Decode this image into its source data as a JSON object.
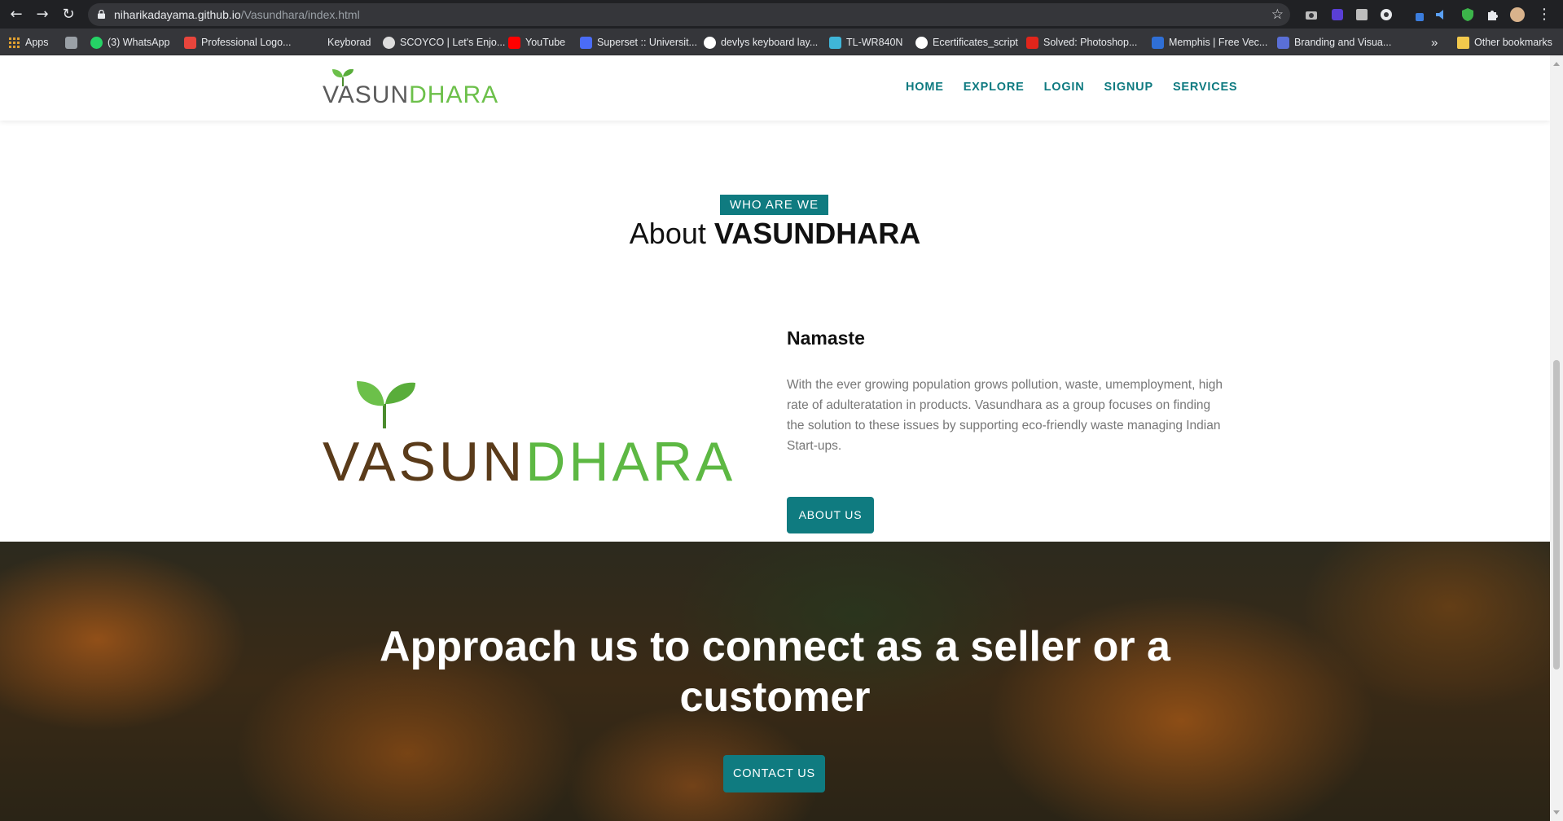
{
  "browser": {
    "url_host": "niharikadayama.github.io",
    "url_path": "/Vasundhara/index.html",
    "bookmarks": [
      {
        "label": "Apps",
        "icon": "apps-grid-icon",
        "color": "#e0a030"
      },
      {
        "label": "",
        "icon": "bookmark-icon",
        "color": "#9aa0a6"
      },
      {
        "label": "(3) WhatsApp",
        "icon": "whatsapp-icon",
        "color": "#25d366"
      },
      {
        "label": "Professional Logo...",
        "icon": "logo-site-icon",
        "color": "#e8453c"
      },
      {
        "label": "Keyborad",
        "icon": "",
        "color": ""
      },
      {
        "label": "SCOYCO | Let's Enjo...",
        "icon": "scoyco-icon",
        "color": "#dddddd"
      },
      {
        "label": "YouTube",
        "icon": "youtube-icon",
        "color": "#ff0000"
      },
      {
        "label": "Superset :: Universit...",
        "icon": "superset-icon",
        "color": "#4a6cf7"
      },
      {
        "label": "devlys keyboard lay...",
        "icon": "google-icon",
        "color": "#ffffff"
      },
      {
        "label": "TL-WR840N",
        "icon": "tplink-icon",
        "color": "#3fb5d8"
      },
      {
        "label": "Ecertificates_script",
        "icon": "github-icon",
        "color": "#ffffff"
      },
      {
        "label": "Solved: Photoshop...",
        "icon": "adobe-icon",
        "color": "#e1251b"
      },
      {
        "label": "Memphis | Free Vec...",
        "icon": "freepik-icon",
        "color": "#2f6fd6"
      },
      {
        "label": "Branding and Visua...",
        "icon": "ieee-icon",
        "color": "#5a6fd6"
      }
    ],
    "more_label": "»",
    "other_bookmarks": "Other bookmarks"
  },
  "site": {
    "brand": {
      "part_a": "VASUN",
      "part_b": "DHARA"
    },
    "nav": [
      "HOME",
      "EXPLORE",
      "LOGIN",
      "SIGNUP",
      "SERVICES"
    ]
  },
  "about": {
    "tag": "WHO ARE WE",
    "title_light": "About",
    "title_strong": "VASUNDHARA",
    "logo_part_a": "VASUN",
    "logo_part_b": "DHARA",
    "heading": "Namaste",
    "text": "With the ever growing population grows pollution, waste, umemployment, high rate of adulteratation in products. Vasundhara as a group focuses on finding the solution to these issues by supporting eco-friendly waste managing Indian Start-ups.",
    "button": "ABOUT US"
  },
  "cta": {
    "title": "Approach us to connect as a seller or a customer",
    "button": "CONTACT US"
  },
  "colors": {
    "accent": "#0f7b80",
    "leaf_green": "#6cc04a",
    "brown": "#5a3b1a"
  }
}
